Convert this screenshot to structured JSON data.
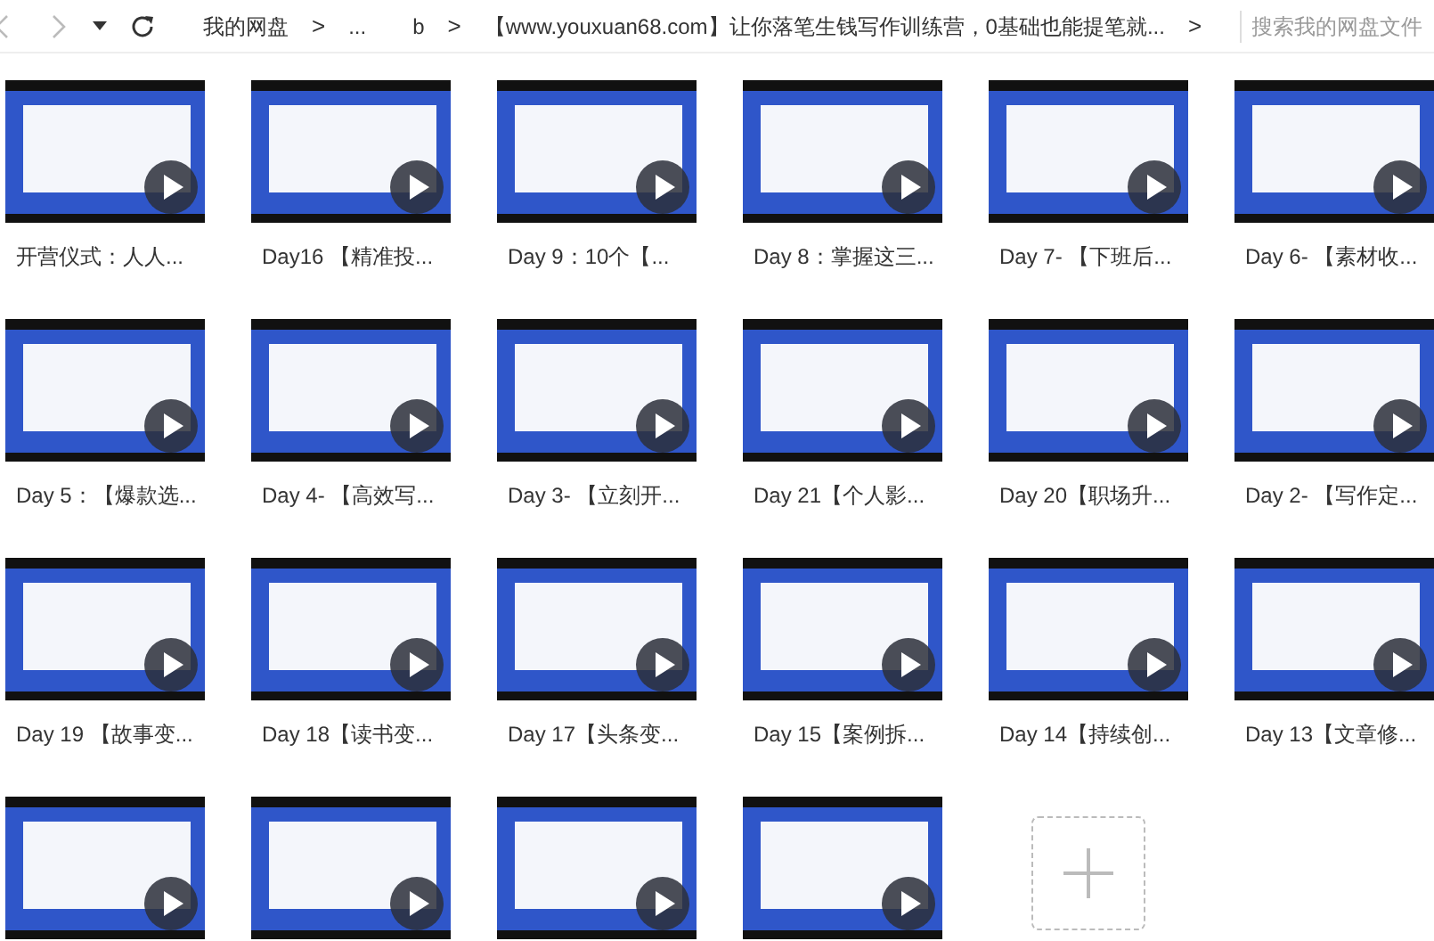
{
  "toolbar": {
    "back": {
      "disabled": true
    },
    "forward": {
      "disabled": true
    }
  },
  "breadcrumb": [
    {
      "label": "我的网盘",
      "separator": ">"
    },
    {
      "label": "..."
    },
    {
      "label": "b",
      "separator": ">"
    },
    {
      "label": "【www.youxuan68.com】让你落笔生钱写作训练营，0基础也能提笔就...",
      "separator": ">"
    }
  ],
  "search": {
    "placeholder": "搜索我的网盘文件"
  },
  "files": [
    {
      "kind": "video",
      "name": "开营仪式：人人..."
    },
    {
      "kind": "video",
      "name": "Day16 【精准投..."
    },
    {
      "kind": "video",
      "name": "Day 9：10个【..."
    },
    {
      "kind": "video",
      "name": "Day 8：掌握这三..."
    },
    {
      "kind": "video",
      "name": "Day 7- 【下班后..."
    },
    {
      "kind": "video",
      "name": "Day 6- 【素材收..."
    },
    {
      "kind": "video",
      "name": "Day 5：【爆款选..."
    },
    {
      "kind": "video",
      "name": "Day 4- 【高效写..."
    },
    {
      "kind": "video",
      "name": "Day 3- 【立刻开..."
    },
    {
      "kind": "video",
      "name": "Day 21【个人影..."
    },
    {
      "kind": "video",
      "name": "Day 20【职场升..."
    },
    {
      "kind": "video",
      "name": "Day 2- 【写作定..."
    },
    {
      "kind": "video",
      "name": "Day 19 【故事变..."
    },
    {
      "kind": "video",
      "name": "Day 18【读书变..."
    },
    {
      "kind": "video",
      "name": "Day 17【头条变..."
    },
    {
      "kind": "video",
      "name": "Day 15【案例拆..."
    },
    {
      "kind": "video",
      "name": "Day 14【持续创..."
    },
    {
      "kind": "video",
      "name": "Day 13【文章修..."
    },
    {
      "kind": "video"
    },
    {
      "kind": "video"
    },
    {
      "kind": "video"
    },
    {
      "kind": "video"
    },
    {
      "kind": "add"
    }
  ]
}
